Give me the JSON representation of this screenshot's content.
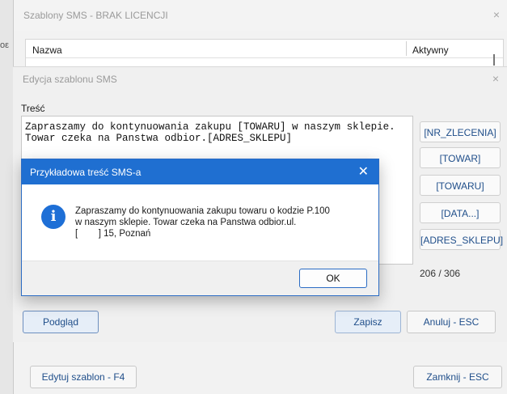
{
  "left_fragment": "oε",
  "outer_window": {
    "title": "Szablony SMS -  BRAK LICENCJI",
    "close_glyph": "×",
    "grid": {
      "columns": [
        "Nazwa",
        "Aktywny"
      ]
    },
    "edit_template_button": "Edytuj szablon - F4",
    "close_button": "Zamknij - ESC"
  },
  "edit_dialog": {
    "title": "Edycja szablonu SMS",
    "close_glyph": "×",
    "content_label": "Treść",
    "content_text": "Zapraszamy do kontynuowania zakupu [TOWARU] w naszym sklepie.\nTowar czeka na Panstwa odbior.[ADRES_SKLEPU]",
    "tags": [
      "[NR_ZLECENIA]",
      "[TOWAR]",
      "[TOWARU]",
      "[DATA...]",
      "[ADRES_SKLEPU]"
    ],
    "counter": "206 / 306",
    "preview_button": "Podgląd",
    "save_button": "Zapisz",
    "cancel_button": "Anuluj - ESC"
  },
  "message_box": {
    "title": "Przykładowa treść SMS-a",
    "close_glyph": "✕",
    "icon": "info-icon",
    "message_lines": [
      "Zapraszamy do kontynuowania zakupu towaru o kodzie P.100",
      "w naszym sklepie. Towar czeka na Panstwa odbior.ul.",
      "[        ] 15, Poznań"
    ],
    "ok_button": "OK"
  },
  "colors": {
    "accent_blue": "#1f6fd1",
    "link_text": "#1f4e8a"
  }
}
